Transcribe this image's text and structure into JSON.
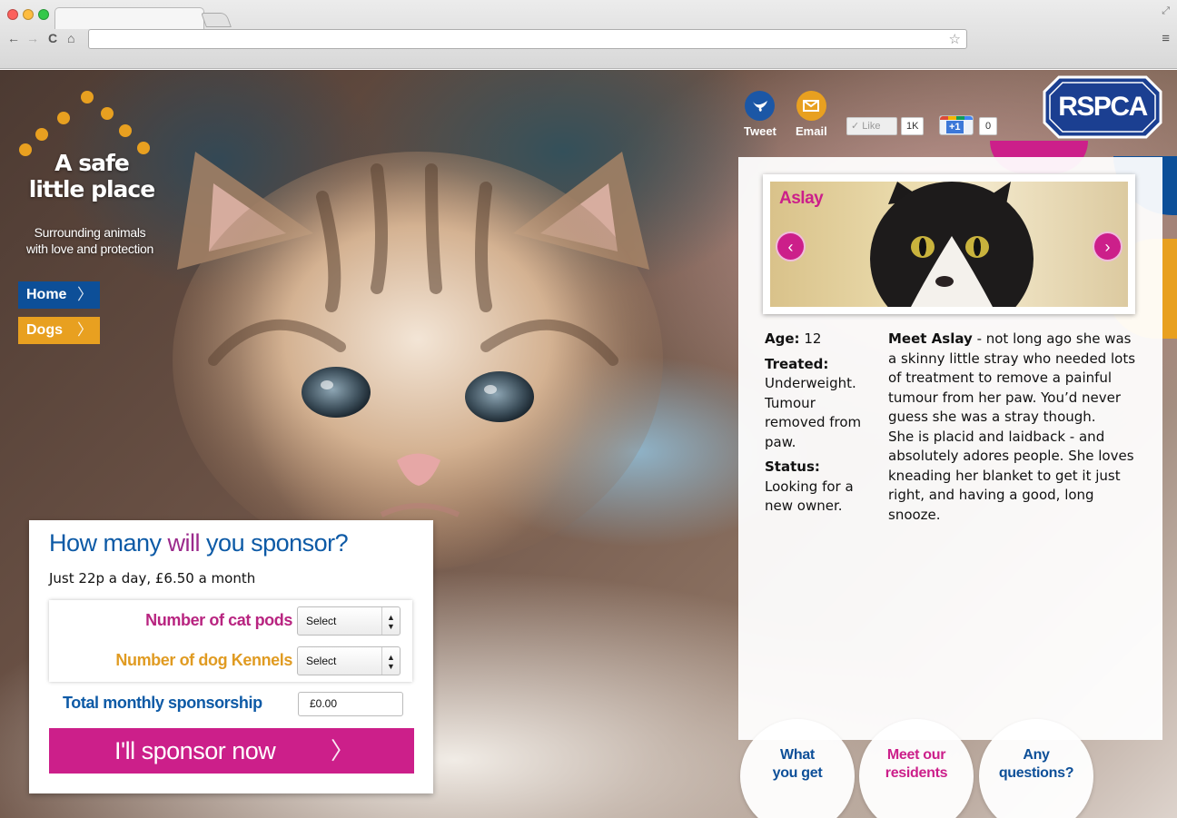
{
  "browser": {
    "back": "←",
    "forward": "→",
    "reload": "C",
    "home": "⌂",
    "star": "☆",
    "menu": "≡",
    "url": ""
  },
  "logo": {
    "title_line1": "A safe",
    "title_line2": "little place",
    "tagline_line1": "Surrounding animals",
    "tagline_line2": "with love and protection"
  },
  "side_nav": [
    {
      "label": "Home",
      "color": "#0d4f98"
    },
    {
      "label": "Dogs",
      "color": "#e8a020"
    }
  ],
  "social": {
    "tweet_label": "Tweet",
    "email_label": "Email",
    "like_label": "✓ Like",
    "like_count": "1K",
    "gplus_label": "+1",
    "gplus_count": "0"
  },
  "brand": {
    "name": "RSPCA",
    "blue": "#0d4f98",
    "pink": "#cc1f8a",
    "yellow": "#e8a020"
  },
  "pet": {
    "name": "Aslay",
    "age_label": "Age:",
    "age_value": "12",
    "treated_label": "Treated:",
    "treated_value": "Underweight. Tumour removed from paw.",
    "status_label": "Status:",
    "status_value": "Looking for a new owner.",
    "bio_intro": "Meet Aslay",
    "bio_rest": " - not long ago she was a skinny little stray who needed lots of treatment to remove a painful tumour from her paw. You’d never guess she was a stray though.",
    "bio_p2": "She is placid and laidback - and absolutely adores people. She loves kneading her blanket to get it just right, and having a good, long snooze."
  },
  "bottom_nav": {
    "what_line1": "What",
    "what_line2": "you get",
    "meet_line1": "Meet our",
    "meet_line2": "residents",
    "any_line1": "Any",
    "any_line2": "questions?"
  },
  "sponsor": {
    "title_a": "How many ",
    "title_b": "will",
    "title_c": " you sponsor?",
    "subtitle": "Just 22p a day, £6.50 a month",
    "cat_label": "Number of cat pods",
    "cat_select": "Select",
    "dog_label": "Number of dog Kennels",
    "dog_select": "Select",
    "total_label": "Total monthly sponsorship",
    "total_value": "£0.00",
    "cta": "I'll sponsor now"
  }
}
